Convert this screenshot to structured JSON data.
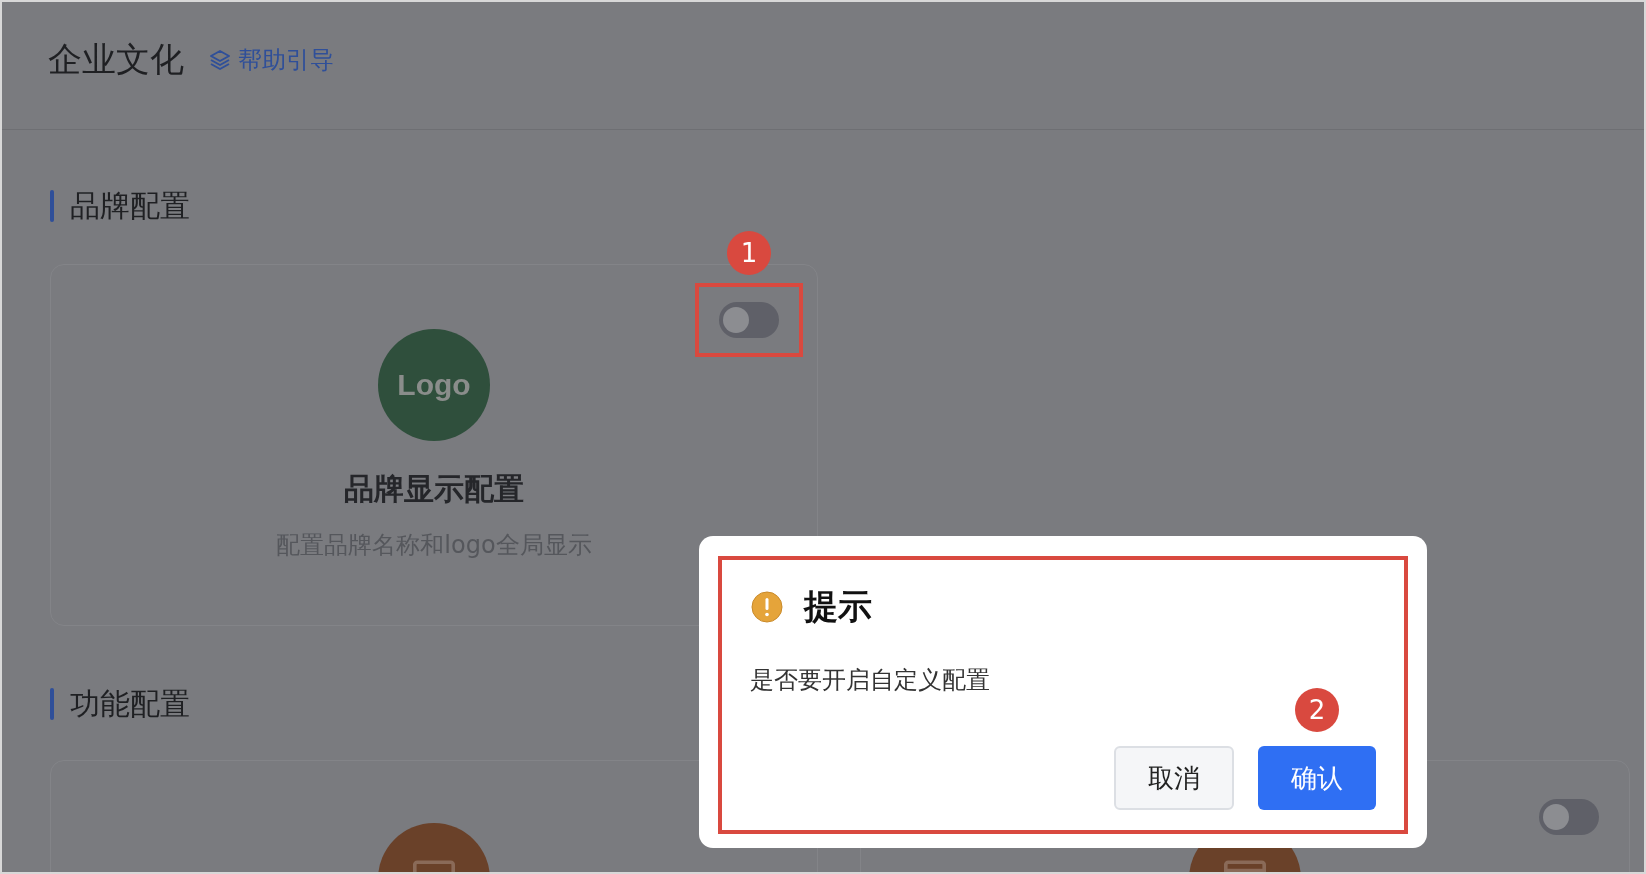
{
  "header": {
    "title": "企业文化",
    "help_link": "帮助引导"
  },
  "sections": [
    {
      "title": "品牌配置",
      "cards": [
        {
          "kind": "logo",
          "logo_text": "Logo",
          "color": "#2f4f3c",
          "title": "品牌显示配置",
          "description": "配置品牌名称和logo全局显示",
          "toggle_on": false,
          "annotation": "1"
        }
      ]
    },
    {
      "title": "功能配置",
      "cards": [
        {
          "kind": "monitor",
          "color": "#6a4129"
        },
        {
          "kind": "browser",
          "color": "#6a4129",
          "toggle_on": false
        }
      ]
    }
  ],
  "dialog": {
    "title": "提示",
    "message": "是否要开启自定义配置",
    "buttons": [
      {
        "label": "取消",
        "kind": "secondary"
      },
      {
        "label": "确认",
        "kind": "primary",
        "annotation": "2"
      }
    ]
  }
}
